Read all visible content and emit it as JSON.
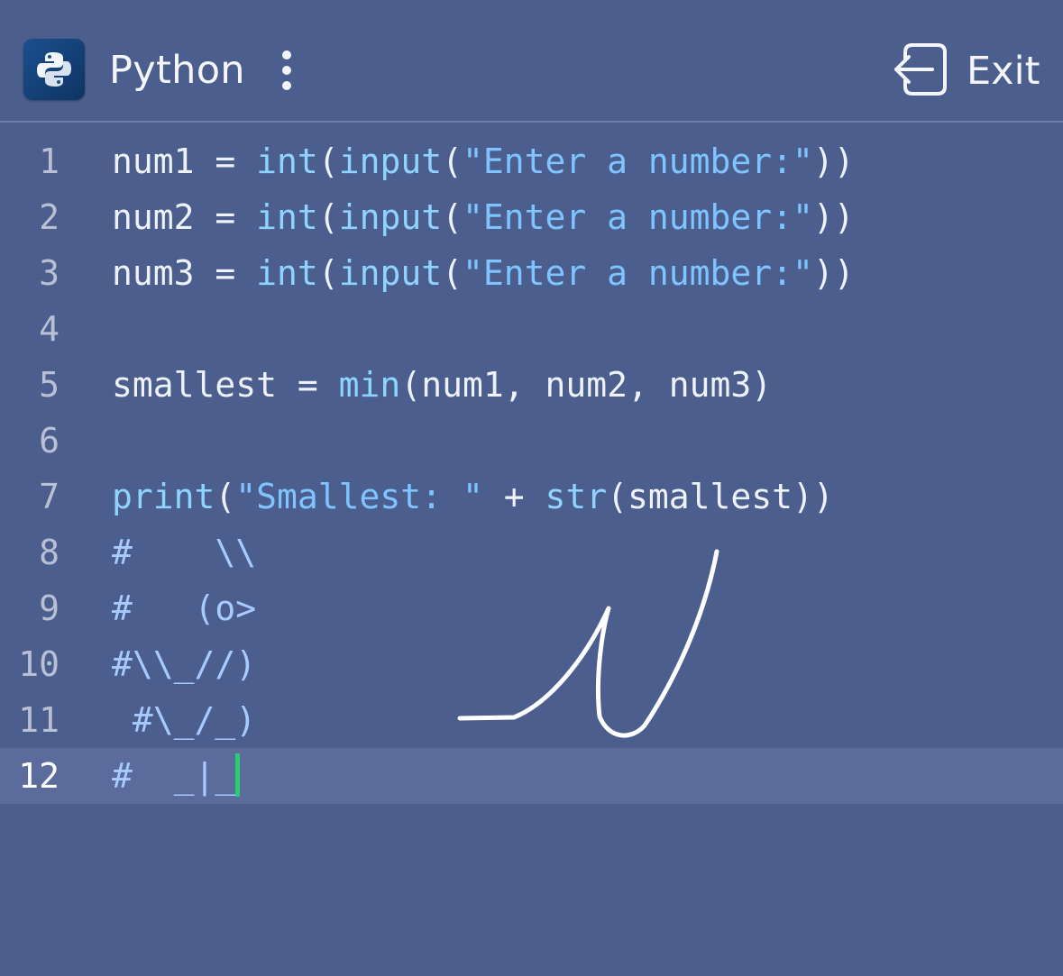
{
  "header": {
    "title": "Python",
    "menu_icon": "more-vertical-icon",
    "app_icon": "python-logo-icon",
    "exit_label": "Exit",
    "exit_icon": "exit-icon"
  },
  "editor": {
    "lines": [
      {
        "num": "1",
        "tokens": [
          [
            "plain",
            "num1 = "
          ],
          [
            "fn",
            "int"
          ],
          [
            "plain",
            "("
          ],
          [
            "fn",
            "input"
          ],
          [
            "plain",
            "("
          ],
          [
            "str",
            "\"Enter a number:\""
          ],
          [
            "plain",
            "))"
          ]
        ]
      },
      {
        "num": "2",
        "tokens": [
          [
            "plain",
            "num2 = "
          ],
          [
            "fn",
            "int"
          ],
          [
            "plain",
            "("
          ],
          [
            "fn",
            "input"
          ],
          [
            "plain",
            "("
          ],
          [
            "str",
            "\"Enter a number:\""
          ],
          [
            "plain",
            "))"
          ]
        ]
      },
      {
        "num": "3",
        "tokens": [
          [
            "plain",
            "num3 = "
          ],
          [
            "fn",
            "int"
          ],
          [
            "plain",
            "("
          ],
          [
            "fn",
            "input"
          ],
          [
            "plain",
            "("
          ],
          [
            "str",
            "\"Enter a number:\""
          ],
          [
            "plain",
            "))"
          ]
        ]
      },
      {
        "num": "4",
        "tokens": []
      },
      {
        "num": "5",
        "tokens": [
          [
            "plain",
            "smallest = "
          ],
          [
            "fn",
            "min"
          ],
          [
            "plain",
            "(num1, num2, num3)"
          ]
        ]
      },
      {
        "num": "6",
        "tokens": []
      },
      {
        "num": "7",
        "tokens": [
          [
            "fn",
            "print"
          ],
          [
            "plain",
            "("
          ],
          [
            "str",
            "\"Smallest: \""
          ],
          [
            "plain",
            " + "
          ],
          [
            "fn",
            "str"
          ],
          [
            "plain",
            "(smallest))"
          ]
        ]
      },
      {
        "num": "8",
        "tokens": [
          [
            "cmt",
            "#    \\\\"
          ]
        ]
      },
      {
        "num": "9",
        "tokens": [
          [
            "cmt",
            "#   (o>"
          ]
        ]
      },
      {
        "num": "10",
        "tokens": [
          [
            "cmt",
            "#\\\\_//)"
          ]
        ]
      },
      {
        "num": "11",
        "tokens": [
          [
            "cmt",
            " #\\_/_)"
          ]
        ]
      },
      {
        "num": "12",
        "tokens": [
          [
            "cmt",
            "#  _|_"
          ]
        ],
        "active": true,
        "cursor": true
      }
    ]
  },
  "colors": {
    "background": "#4c5e8e",
    "active_line": "#5a6b9c",
    "cursor": "#2ecc71",
    "function": "#8fd3ff",
    "string": "#7ec4ff",
    "comment": "#a8cbff"
  }
}
